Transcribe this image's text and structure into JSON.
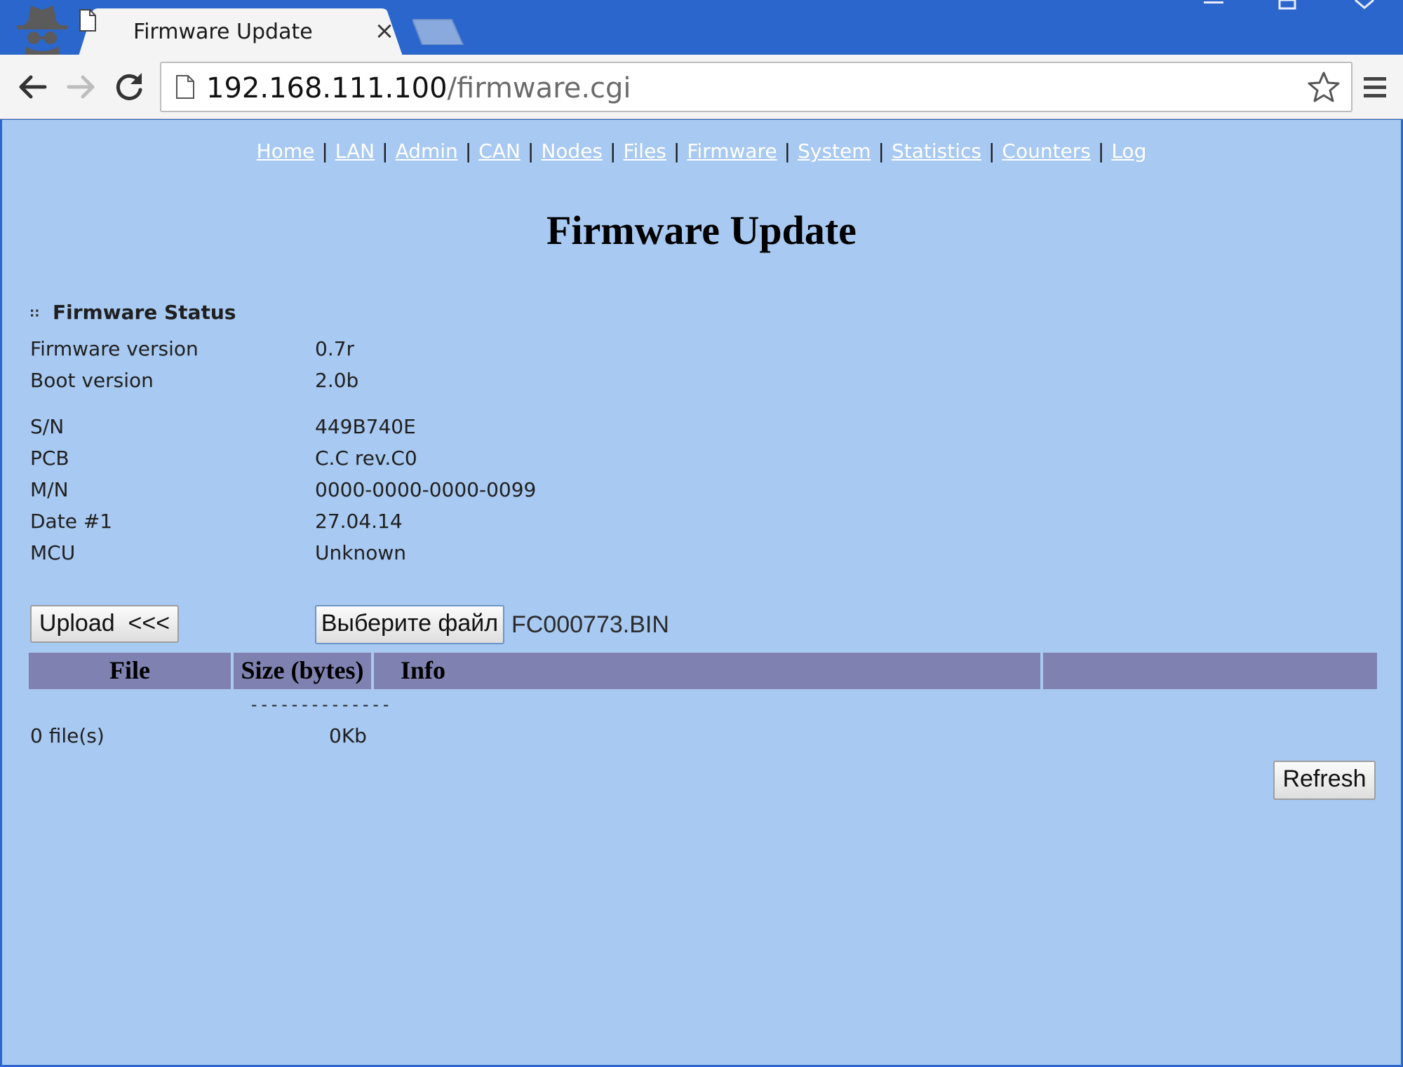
{
  "browser": {
    "tab": {
      "title": "Firmware Update"
    },
    "address": {
      "host": "192.168.111.100",
      "path": "/firmware.cgi"
    }
  },
  "nav": {
    "links": [
      {
        "label": "Home"
      },
      {
        "label": "LAN"
      },
      {
        "label": "Admin"
      },
      {
        "label": "CAN"
      },
      {
        "label": "Nodes"
      },
      {
        "label": "Files"
      },
      {
        "label": "Firmware"
      },
      {
        "label": "System"
      },
      {
        "label": "Statistics"
      },
      {
        "label": "Counters"
      },
      {
        "label": "Log"
      }
    ],
    "separator": "|"
  },
  "page": {
    "title": "Firmware Update",
    "status_section": {
      "bullet": "∷",
      "heading": "Firmware Status",
      "rows": [
        {
          "label": "Firmware version",
          "value": "0.7r"
        },
        {
          "label": "Boot version",
          "value": "2.0b"
        },
        {
          "label": "S/N",
          "value": "449B740E"
        },
        {
          "label": "PCB",
          "value": "C.C rev.C0"
        },
        {
          "label": "M/N",
          "value": "0000-0000-0000-0099"
        },
        {
          "label": "Date #1",
          "value": "27.04.14"
        },
        {
          "label": "MCU",
          "value": "Unknown"
        }
      ]
    },
    "upload": {
      "upload_label": "Upload  <<<",
      "choose_label": "Выберите файл",
      "chosen_file": "FC000773.BIN"
    },
    "files": {
      "headers": {
        "file": "File",
        "size": "Size (bytes)",
        "info": "Info",
        "extra": ""
      },
      "separator": "--------------",
      "count": "0 file(s)",
      "total": "0Kb"
    },
    "refresh_label": "Refresh"
  },
  "colors": {
    "page_bg": "#a8c9f1",
    "table_header_bg": "#7f82b0",
    "titlebar_bg": "#2b66cc"
  }
}
